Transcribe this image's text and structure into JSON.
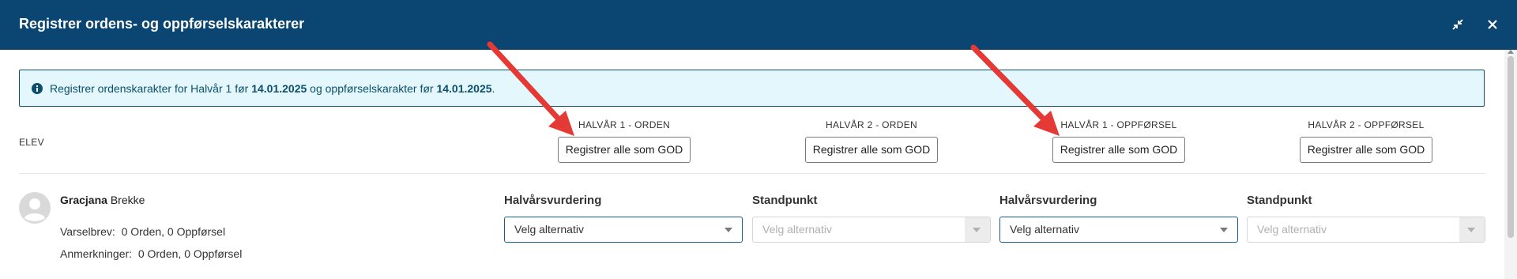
{
  "header": {
    "title": "Registrer ordens- og oppførselskarakterer",
    "minimize_icon": "minimize-icon",
    "close_icon": "close-icon"
  },
  "info": {
    "icon": "info-icon",
    "text_before": "Registrer ordenskarakter for Halvår 1 før ",
    "date1": "14.01.2025",
    "text_middle": " og oppførselskarakter før ",
    "date2": "14.01.2025",
    "text_after": "."
  },
  "columns": {
    "elev": "ELEV",
    "groups": [
      {
        "label": "HALVÅR 1 - ORDEN",
        "button": "Registrer alle som GOD"
      },
      {
        "label": "HALVÅR 2 - ORDEN",
        "button": "Registrer alle som GOD"
      },
      {
        "label": "HALVÅR 1 - OPPFØRSEL",
        "button": "Registrer alle som GOD"
      },
      {
        "label": "HALVÅR 2 - OPPFØRSEL",
        "button": "Registrer alle som GOD"
      }
    ]
  },
  "student": {
    "first_name": "Gracjana",
    "last_name": "Brekke",
    "varselbrev_label": "Varselbrev:",
    "varselbrev_value": "0 Orden, 0 Oppførsel",
    "anmerkninger_label": "Anmerkninger:",
    "anmerkninger_value": "0 Orden, 0 Oppførsel",
    "fields": [
      {
        "label": "Halvårsvurdering",
        "value": "Velg alternativ",
        "disabled": false
      },
      {
        "label": "Standpunkt",
        "value": "Velg alternativ",
        "disabled": true
      },
      {
        "label": "Halvårsvurdering",
        "value": "Velg alternativ",
        "disabled": false
      },
      {
        "label": "Standpunkt",
        "value": "Velg alternativ",
        "disabled": true
      }
    ]
  },
  "colors": {
    "header_bg": "#0b4673",
    "info_bg": "#e3f7fc",
    "annotation_arrow": "#e53935"
  }
}
